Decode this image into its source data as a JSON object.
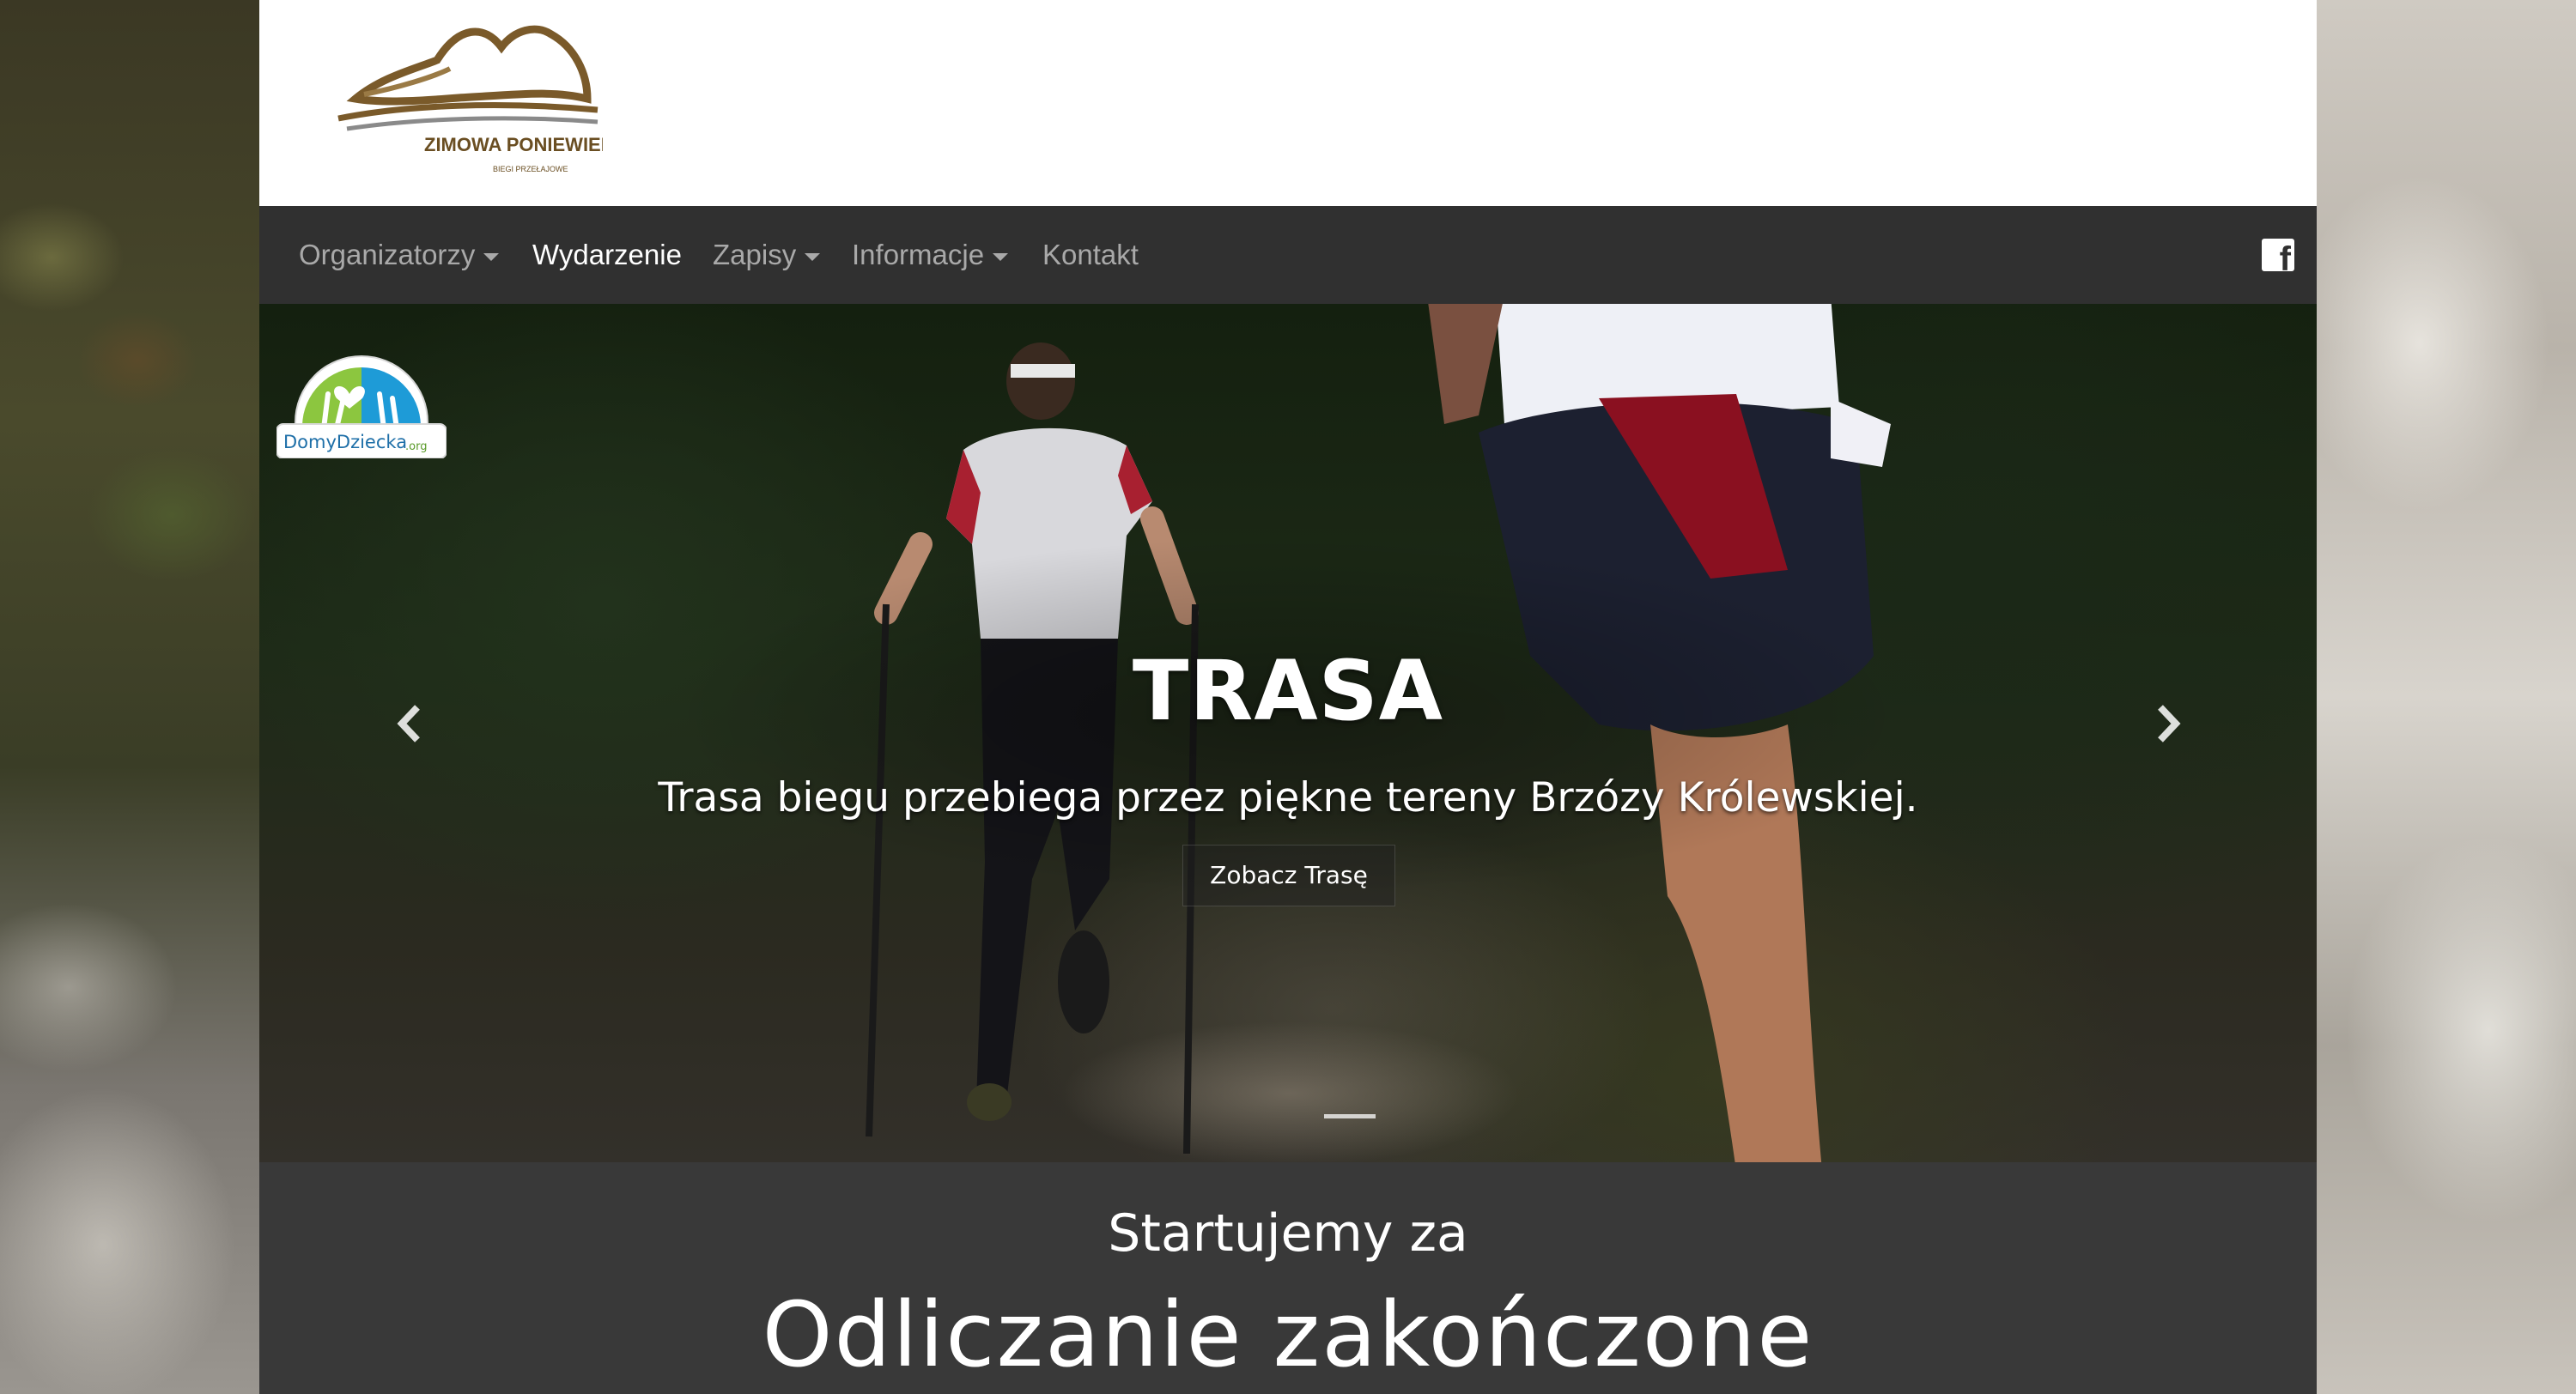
{
  "logo": {
    "name": "ZIMOWA PONIEWIERKA",
    "tagline": "BIEGI PRZEŁAJOWE"
  },
  "nav": {
    "items": [
      {
        "label": "Organizatorzy",
        "dropdown": true,
        "active": false
      },
      {
        "label": "Wydarzenie",
        "dropdown": false,
        "active": true
      },
      {
        "label": "Zapisy",
        "dropdown": true,
        "active": false
      },
      {
        "label": "Informacje",
        "dropdown": true,
        "active": false
      },
      {
        "label": "Kontakt",
        "dropdown": false,
        "active": false
      }
    ],
    "social_icon": "facebook-icon"
  },
  "hero": {
    "badge": {
      "name": "DomyDziecka",
      "suffix": ".org"
    },
    "title": "TRASA",
    "subtitle": "Trasa biegu przebiega przez piękne tereny Brzózy Królewskiej.",
    "button_label": "Zobacz Trasę",
    "prev_icon": "chevron-left-icon",
    "next_icon": "chevron-right-icon"
  },
  "countdown": {
    "label": "Startujemy za",
    "status": "Odliczanie zakończone"
  },
  "colors": {
    "navbar_bg": "#303030",
    "nav_text": "#a9a9a9",
    "nav_active": "#ffffff",
    "countdown_bg": "#393939",
    "logo_brown": "#7a5a2a"
  }
}
